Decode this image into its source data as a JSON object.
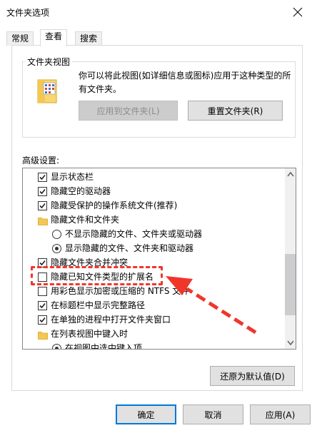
{
  "window": {
    "title": "文件夹选项"
  },
  "tabs": [
    {
      "label": "常规",
      "active": false
    },
    {
      "label": "查看",
      "active": true
    },
    {
      "label": "搜索",
      "active": false
    }
  ],
  "folder_views": {
    "group_label": "文件夹视图",
    "description": "你可以将此视图(如详细信息或图标)应用于这种类型的所有文件夹。",
    "apply_button": "应用到文件夹(L)",
    "reset_button": "重置文件夹(R)"
  },
  "advanced": {
    "label": "高级设置:",
    "items": [
      {
        "kind": "checkbox",
        "checked": true,
        "indent": 0,
        "label": "显示状态栏"
      },
      {
        "kind": "checkbox",
        "checked": true,
        "indent": 0,
        "label": "隐藏空的驱动器"
      },
      {
        "kind": "checkbox",
        "checked": true,
        "indent": 0,
        "label": "隐藏受保护的操作系统文件(推荐)"
      },
      {
        "kind": "folder",
        "indent": 0,
        "label": "隐藏文件和文件夹"
      },
      {
        "kind": "radio",
        "checked": false,
        "indent": 1,
        "label": "不显示隐藏的文件、文件夹或驱动器"
      },
      {
        "kind": "radio",
        "checked": true,
        "indent": 1,
        "label": "显示隐藏的文件、文件夹和驱动器"
      },
      {
        "kind": "checkbox",
        "checked": true,
        "indent": 0,
        "label": "隐藏文件夹合并冲突"
      },
      {
        "kind": "checkbox",
        "checked": false,
        "indent": 0,
        "label": "隐藏已知文件类型的扩展名"
      },
      {
        "kind": "checkbox",
        "checked": false,
        "indent": 0,
        "label": "用彩色显示加密或压缩的 NTFS 文件"
      },
      {
        "kind": "checkbox",
        "checked": true,
        "indent": 0,
        "label": "在标题栏中显示完整路径"
      },
      {
        "kind": "checkbox",
        "checked": true,
        "indent": 0,
        "label": "在单独的进程中打开文件夹窗口"
      },
      {
        "kind": "folder",
        "indent": 0,
        "label": "在列表视图中键入时"
      },
      {
        "kind": "radio",
        "checked": true,
        "indent": 1,
        "label": "在视图中选中键入项"
      }
    ]
  },
  "restore_defaults_button": "还原为默认值(D)",
  "footer": {
    "ok": "确定",
    "cancel": "取消",
    "apply": "应用(A)"
  },
  "annotation": {
    "color": "#f0362b"
  }
}
